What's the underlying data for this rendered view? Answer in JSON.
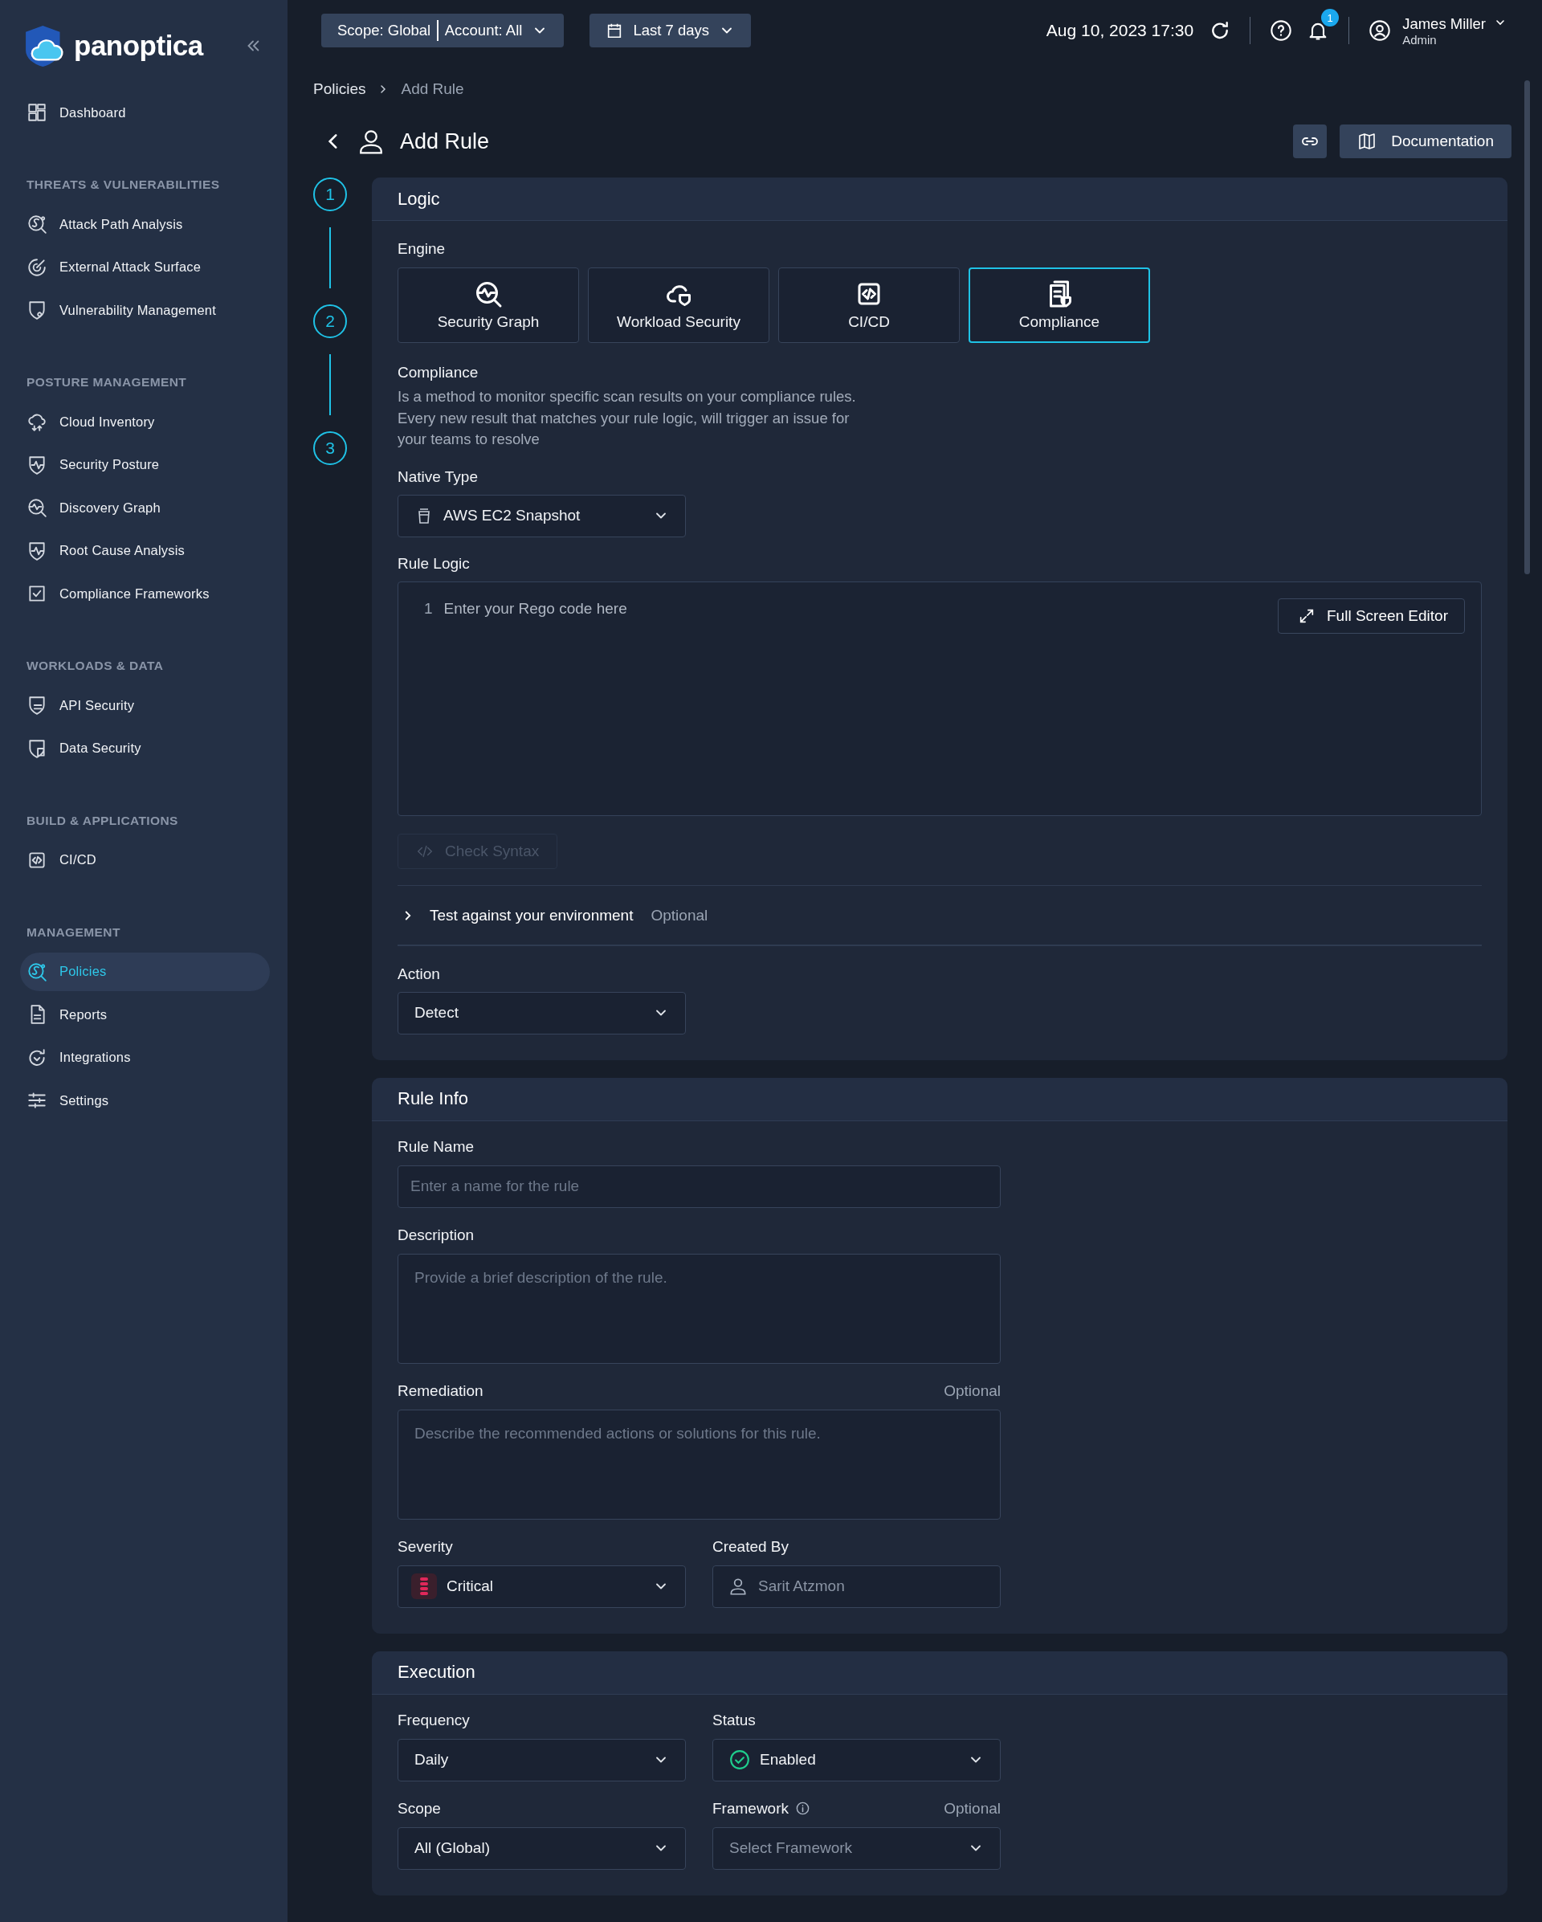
{
  "brand": {
    "name": "panoptica"
  },
  "sidebar": {
    "sections": [
      {
        "items": [
          {
            "label": "Dashboard",
            "selected": false
          }
        ]
      },
      {
        "heading": "THREATS & VULNERABILITIES",
        "items": [
          {
            "label": "Attack Path Analysis",
            "selected": false
          },
          {
            "label": "External Attack Surface",
            "selected": false
          },
          {
            "label": "Vulnerability Management",
            "selected": false
          }
        ]
      },
      {
        "heading": "POSTURE MANAGEMENT",
        "items": [
          {
            "label": "Cloud Inventory",
            "selected": false
          },
          {
            "label": "Security Posture",
            "selected": false
          },
          {
            "label": "Discovery Graph",
            "selected": false
          },
          {
            "label": "Root Cause Analysis",
            "selected": false
          },
          {
            "label": "Compliance Frameworks",
            "selected": false
          }
        ]
      },
      {
        "heading": "WORKLOADS & DATA",
        "items": [
          {
            "label": "API Security",
            "selected": false
          },
          {
            "label": "Data Security",
            "selected": false
          }
        ]
      },
      {
        "heading": "BUILD & APPLICATIONS",
        "items": [
          {
            "label": "CI/CD",
            "selected": false
          }
        ]
      },
      {
        "heading": "MANAGEMENT",
        "items": [
          {
            "label": "Policies",
            "selected": true
          },
          {
            "label": "Reports",
            "selected": false
          },
          {
            "label": "Integrations",
            "selected": false
          },
          {
            "label": "Settings",
            "selected": false
          }
        ]
      }
    ]
  },
  "top_bar": {
    "scope": "Scope: Global",
    "account": "Account: All",
    "time_range": "Last 7 days",
    "timestamp": "Aug 10, 2023 17:30",
    "notification_count": "1",
    "user": {
      "name": "James Miller",
      "role": "Admin"
    }
  },
  "breadcrumb": [
    "Policies",
    "Add Rule"
  ],
  "page_title": "Add Rule",
  "documentation_button": "Documentation",
  "steps": [
    "1",
    "2",
    "3"
  ],
  "logic": {
    "title": "Logic",
    "engine_label": "Engine",
    "engines": [
      {
        "label": "Security Graph",
        "selected": false
      },
      {
        "label": "Workload Security",
        "selected": false
      },
      {
        "label": "CI/CD",
        "selected": false
      },
      {
        "label": "Compliance",
        "selected": true
      }
    ],
    "description_title": "Compliance",
    "description": "Is a method to monitor specific scan results on your compliance rules. Every new result that matches your rule logic, will trigger an issue for your teams to resolve",
    "native_type": {
      "label": "Native Type",
      "value": "AWS EC2 Snapshot"
    },
    "rule_logic": {
      "label": "Rule Logic",
      "line_number": "1",
      "placeholder": "Enter your Rego code here",
      "full_screen_button": "Full Screen Editor"
    },
    "check_syntax": {
      "label": "Check Syntax",
      "disabled": true
    },
    "test": {
      "label": "Test against your environment",
      "note": "Optional",
      "expanded": false
    },
    "action": {
      "label": "Action",
      "value": "Detect"
    }
  },
  "rule_info": {
    "title": "Rule Info",
    "rows": [
      [
        {
          "label": "Rule Name",
          "kind": "input",
          "placeholder": "Enter a name for the rule"
        }
      ],
      [
        {
          "label": "Description",
          "kind": "textarea",
          "placeholder": "Provide a brief description of the rule."
        }
      ],
      [
        {
          "label": "Remediation",
          "note": "Optional",
          "kind": "textarea",
          "placeholder": "Describe the recommended actions or solutions for this rule."
        }
      ],
      [
        {
          "label": "Severity",
          "kind": "severity",
          "value": "Critical"
        },
        {
          "label": "Created By",
          "kind": "person",
          "value": "Sarit Atzmon"
        }
      ]
    ]
  },
  "execution": {
    "title": "Execution",
    "rows": [
      [
        {
          "label": "Frequency",
          "kind": "select",
          "value": "Daily"
        },
        {
          "label": "Status",
          "kind": "status",
          "value": "Enabled"
        }
      ],
      [
        {
          "label": "Scope",
          "kind": "select",
          "value": "All (Global)"
        },
        {
          "label": "Framework",
          "info": true,
          "note": "Optional",
          "kind": "select",
          "placeholder": "Select Framework"
        }
      ]
    ]
  }
}
